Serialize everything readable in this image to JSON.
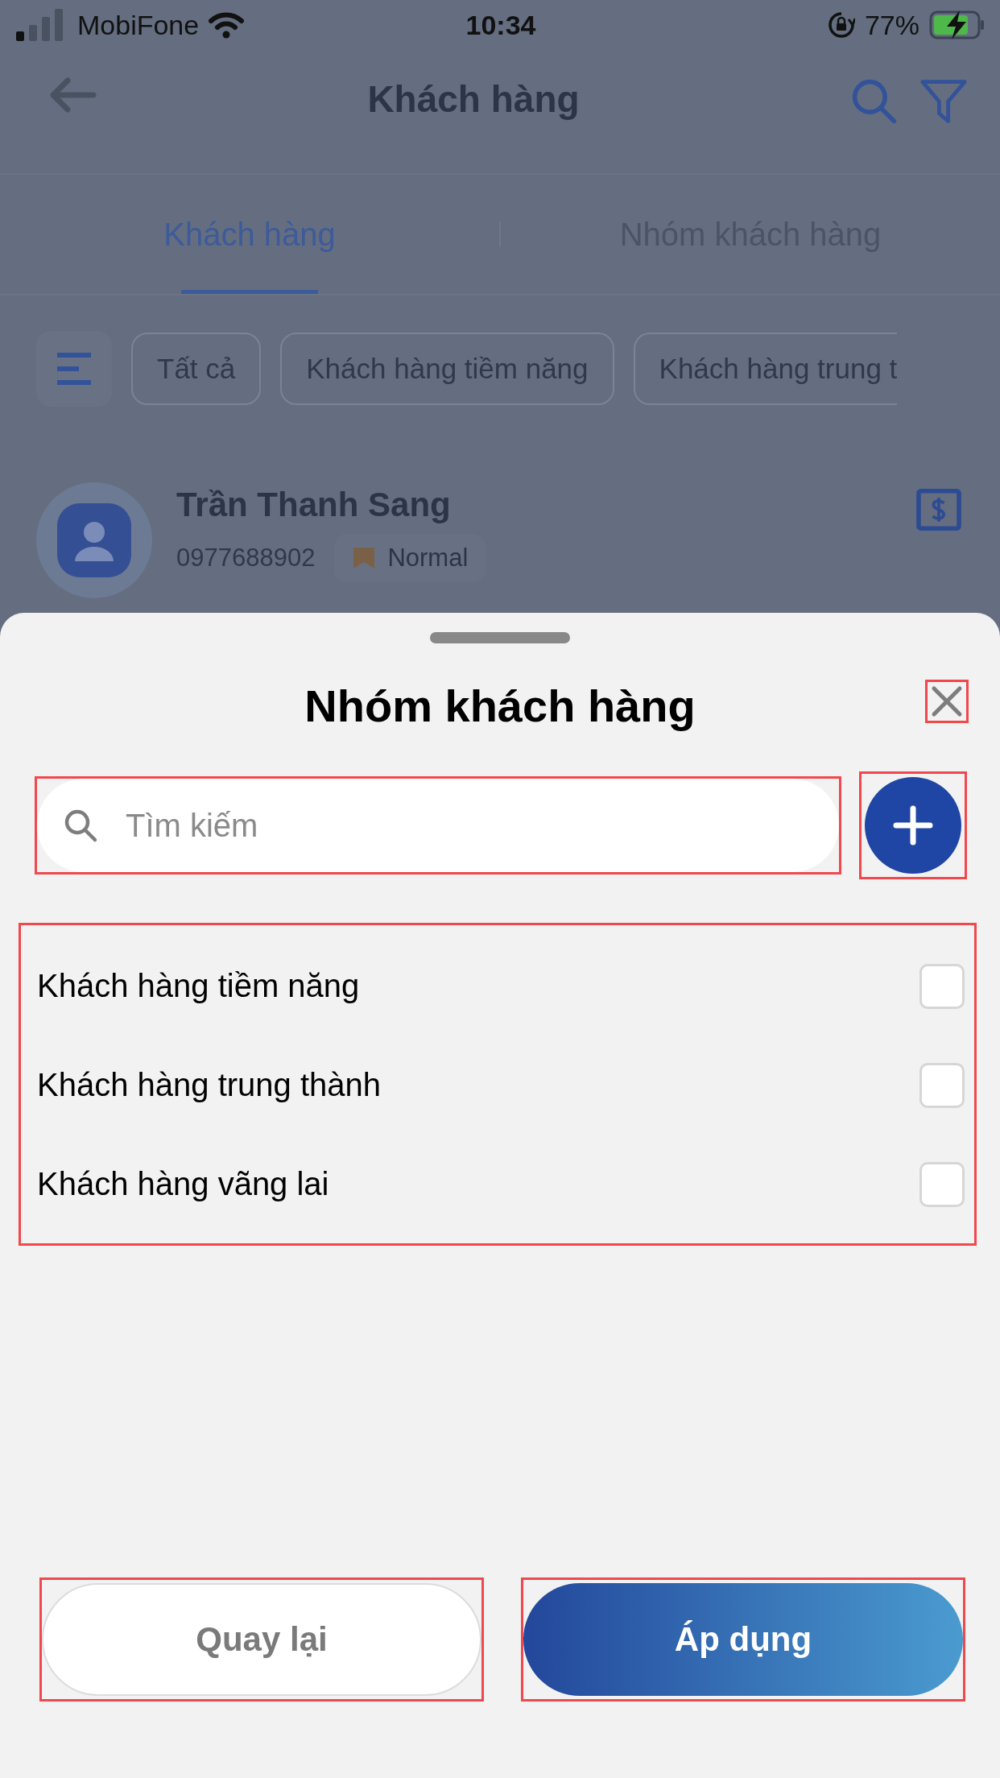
{
  "status_bar": {
    "carrier": "MobiFone",
    "time": "10:34",
    "battery": "77%"
  },
  "header": {
    "title": "Khách hàng"
  },
  "tabs": [
    {
      "label": "Khách hàng",
      "selected": true
    },
    {
      "label": "Nhóm khách hàng",
      "selected": false
    }
  ],
  "filter_chips": [
    {
      "label": "Tất cả"
    },
    {
      "label": "Khách hàng tiềm năng"
    },
    {
      "label": "Khách hàng trung t"
    }
  ],
  "customer": {
    "name": "Trần Thanh Sang",
    "phone": "0977688902",
    "tier": "Normal"
  },
  "sheet": {
    "title": "Nhóm khách hàng",
    "close_highlighted": true,
    "search": {
      "placeholder": "Tìm kiếm",
      "highlighted": true
    },
    "add_highlighted": true,
    "list_highlighted": true,
    "groups": [
      {
        "label": "Khách hàng tiềm năng",
        "checked": false
      },
      {
        "label": "Khách hàng trung thành",
        "checked": false
      },
      {
        "label": "Khách hàng vãng lai",
        "checked": false
      }
    ],
    "buttons": [
      {
        "kind": "secondary",
        "label": "Quay lại",
        "highlighted": true
      },
      {
        "kind": "primary",
        "label": "Áp dụng",
        "highlighted": true
      }
    ]
  }
}
